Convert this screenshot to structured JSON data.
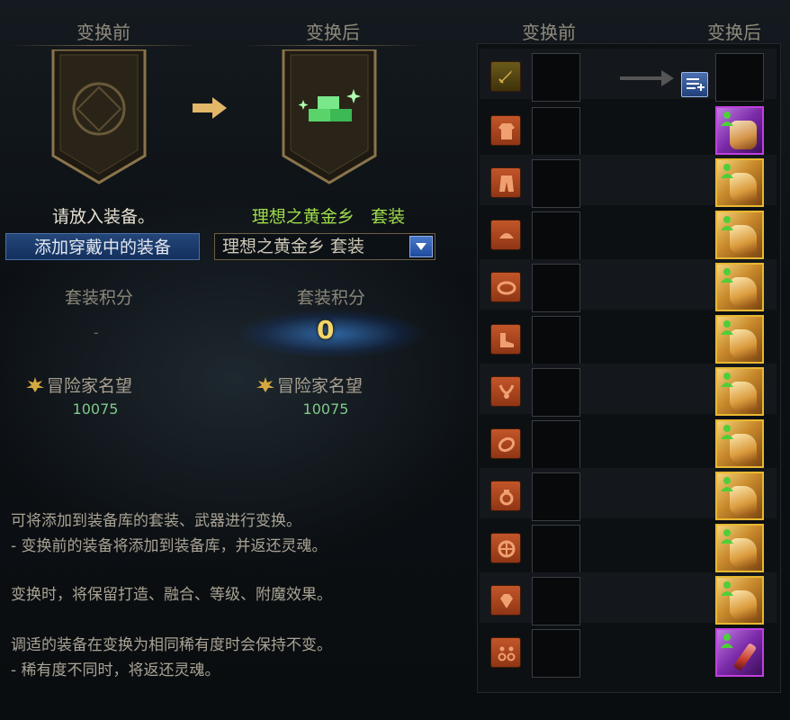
{
  "left": {
    "header_before": "变换前",
    "header_after": "变换后",
    "status_before": "请放入装备。",
    "status_after_name": "理想之黄金乡",
    "status_after_suffix": "套装",
    "add_equipped_button": "添加穿戴中的装备",
    "set_select_value": "理想之黄金乡  套装",
    "points_label_before": "套装积分",
    "points_value_before": "-",
    "points_label_after": "套装积分",
    "points_value_after": "0",
    "fame_label_before": "冒险家名望",
    "fame_value_before": "10075",
    "fame_label_after": "冒险家名望",
    "fame_value_after": "10075"
  },
  "description": {
    "line1": "可将添加到装备库的套装、武器进行变换。",
    "line2": "- 变换前的装备将添加到装备库，并返还灵魂。",
    "line3": "变换时，将保留打造、融合、等级、附魔效果。",
    "line4": "调适的装备在变换为相同稀有度时会保持不变。",
    "line5": "- 稀有度不同时，将返还灵魂。"
  },
  "right": {
    "header_before": "变换前",
    "header_after": "变换后",
    "rows": [
      {
        "slot": "weapon-icon",
        "after": "empty"
      },
      {
        "slot": "top-icon",
        "after": "epic"
      },
      {
        "slot": "pants-icon",
        "after": "legendary"
      },
      {
        "slot": "shoulder-icon",
        "after": "legendary"
      },
      {
        "slot": "belt-icon",
        "after": "legendary"
      },
      {
        "slot": "shoes-icon",
        "after": "legendary"
      },
      {
        "slot": "necklace-icon",
        "after": "legendary"
      },
      {
        "slot": "bracelet-icon",
        "after": "legendary"
      },
      {
        "slot": "ring-icon",
        "after": "legendary"
      },
      {
        "slot": "support-icon",
        "after": "legendary"
      },
      {
        "slot": "magic-stone-icon",
        "after": "legendary"
      },
      {
        "slot": "earring-icon",
        "after": "epic"
      }
    ]
  },
  "colors": {
    "gold_text": "#b8e07a",
    "status_after": "#9fdc4a",
    "legendary_border": "#e8b830",
    "epic_border": "#c040e0",
    "fame_value": "#7fc98a"
  }
}
